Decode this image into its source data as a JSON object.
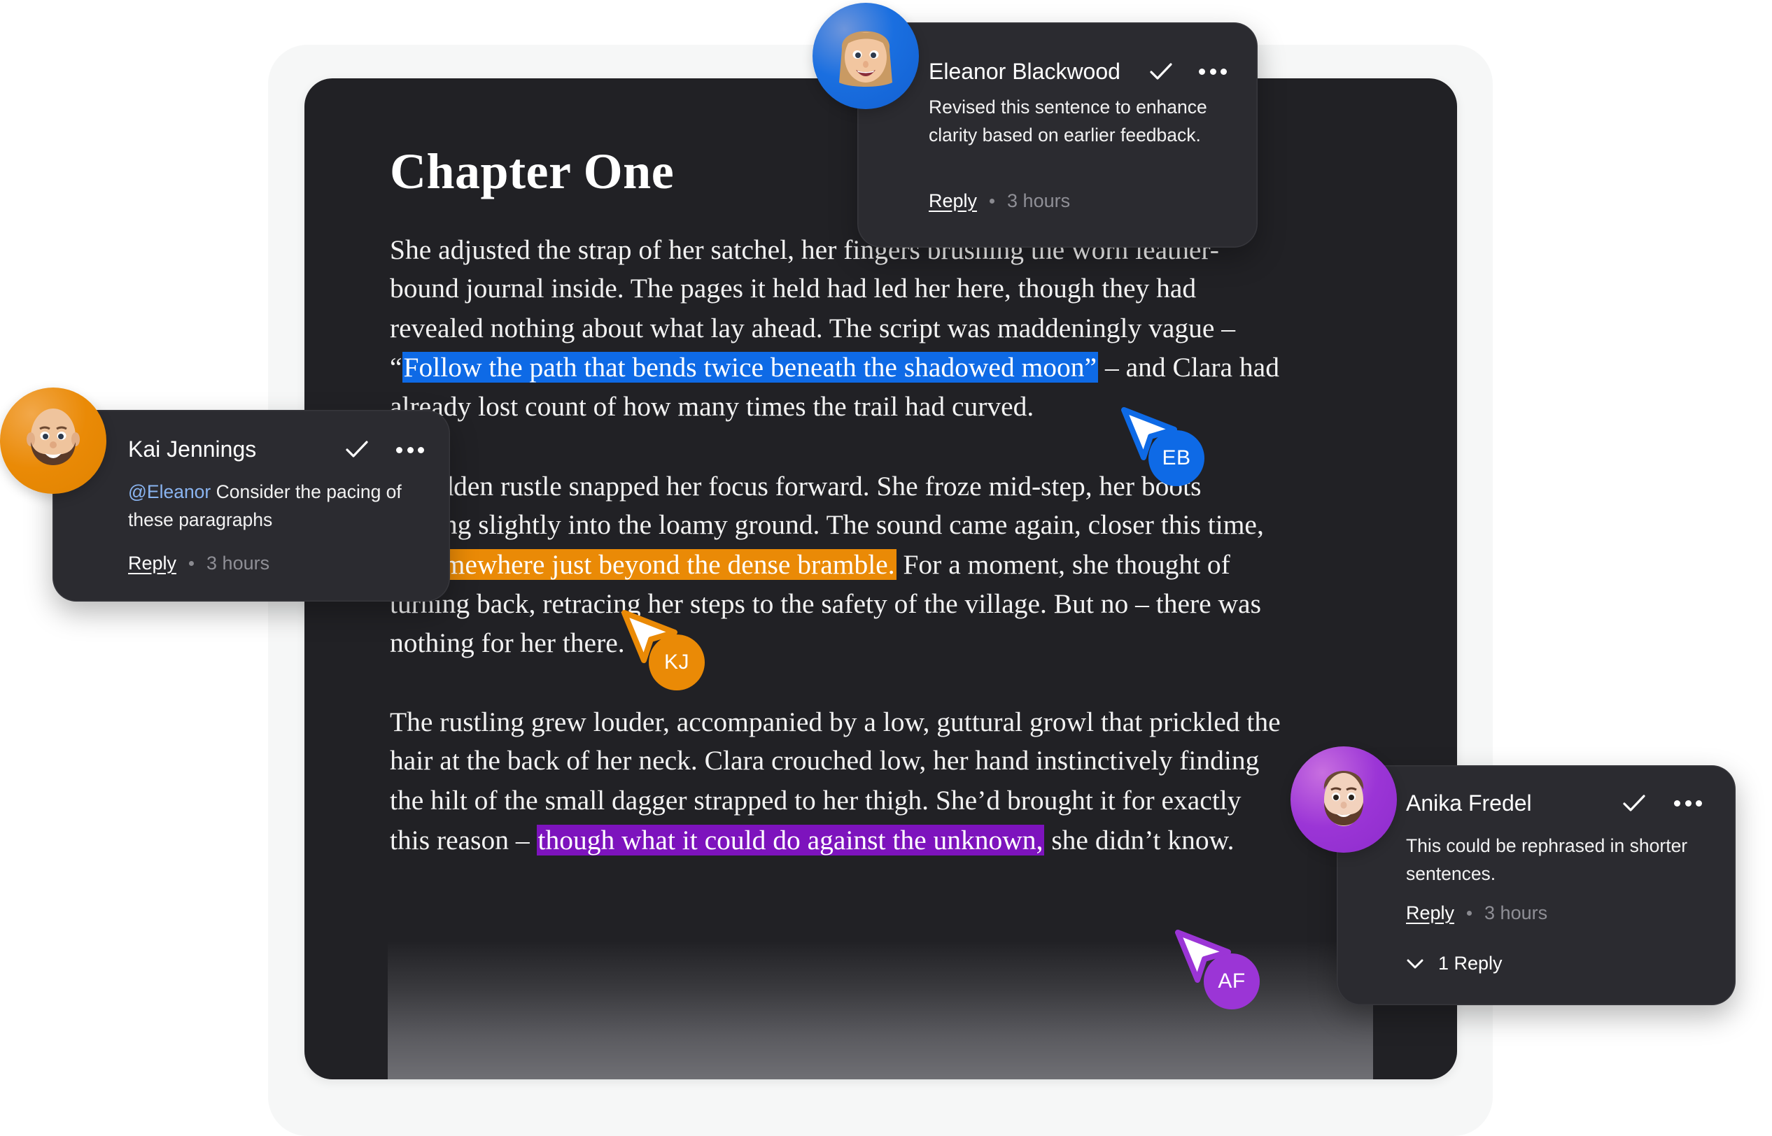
{
  "document": {
    "title": "Chapter One",
    "lines": [
      {
        "segments": [
          {
            "text": "She adjusted the strap of her satchel, her fingers brushing the worn leather-"
          }
        ]
      },
      {
        "segments": [
          {
            "text": "bound journal inside. The pages it held had led her here, though they had"
          }
        ]
      },
      {
        "segments": [
          {
            "text": "revealed nothing about what lay ahead. The script was maddeningly vague –"
          }
        ]
      },
      {
        "segments": [
          {
            "text": "“"
          },
          {
            "text": "Follow the path that bends twice beneath the shadowed moon”",
            "highlight": "blue"
          },
          {
            "text": " – and Clara had"
          }
        ]
      },
      {
        "segments": [
          {
            "text": "already lost count of how many times the trail had curved."
          }
        ]
      },
      {
        "segments": [
          {
            "text": "A sudden rustle snapped her focus forward. She froze mid-step, her boots"
          }
        ]
      },
      {
        "segments": [
          {
            "text": "sinking slightly into the loamy ground. The sound came again, closer this time,"
          }
        ]
      },
      {
        "segments": [
          {
            "text": "    "
          },
          {
            "text": "somewhere just beyond the dense bramble.",
            "highlight": "orange"
          },
          {
            "text": " For a moment, she thought of"
          }
        ]
      },
      {
        "segments": [
          {
            "text": "turning back, retracing her steps to the safety of the village. But no – there was"
          }
        ]
      },
      {
        "segments": [
          {
            "text": "nothing for her there."
          }
        ]
      },
      {
        "segments": [
          {
            "text": "The rustling grew louder, accompanied by a low, guttural growl that prickled the"
          }
        ]
      },
      {
        "segments": [
          {
            "text": "hair at the back of her neck. Clara crouched low, her hand instinctively finding"
          }
        ]
      },
      {
        "segments": [
          {
            "text": "the hilt of the small dagger strapped to her thigh. She’d brought it for exactly"
          }
        ]
      },
      {
        "segments": [
          {
            "text": "this reason – "
          },
          {
            "text": "though what it could do against the unknown,",
            "highlight": "purple"
          },
          {
            "text": " she didn’t know."
          }
        ]
      }
    ]
  },
  "comments": [
    {
      "id": "eleanor",
      "author": "Eleanor Blackwood",
      "body_mention": "",
      "body": "Revised this sentence to enhance clarity based on earlier feedback.",
      "reply_label": "Reply",
      "time": "3 hours",
      "resolve_icon": "check-icon",
      "more_icon": "more-horizontal-icon",
      "avatar_color": "#1a6fe0"
    },
    {
      "id": "kai",
      "author": "Kai Jennings",
      "body_mention": "@Eleanor",
      "body": " Consider the pacing of these paragraphs",
      "reply_label": "Reply",
      "time": "3 hours",
      "resolve_icon": "check-icon",
      "more_icon": "more-horizontal-icon",
      "avatar_color": "#ea8a06"
    },
    {
      "id": "anika",
      "author": "Anika Fredel",
      "body_mention": "",
      "body": "This could be rephrased in shorter sentences.",
      "reply_label": "Reply",
      "time": "3 hours",
      "thread_label": "1 Reply",
      "thread_icon": "chevron-down-icon",
      "resolve_icon": "check-icon",
      "more_icon": "more-horizontal-icon",
      "avatar_color": "#9b35d6"
    }
  ],
  "cursors": [
    {
      "initials": "EB",
      "color": "#0e6ae6"
    },
    {
      "initials": "KJ",
      "color": "#ea8a06"
    },
    {
      "initials": "AF",
      "color": "#9b35d6"
    }
  ],
  "colors": {
    "highlight_blue": "#0e6ae6",
    "highlight_orange": "#ea8a06",
    "highlight_purple": "#7d13bd",
    "doc_background": "#212125",
    "card_background": "#2b2b30",
    "mention": "#8ab4f0"
  }
}
